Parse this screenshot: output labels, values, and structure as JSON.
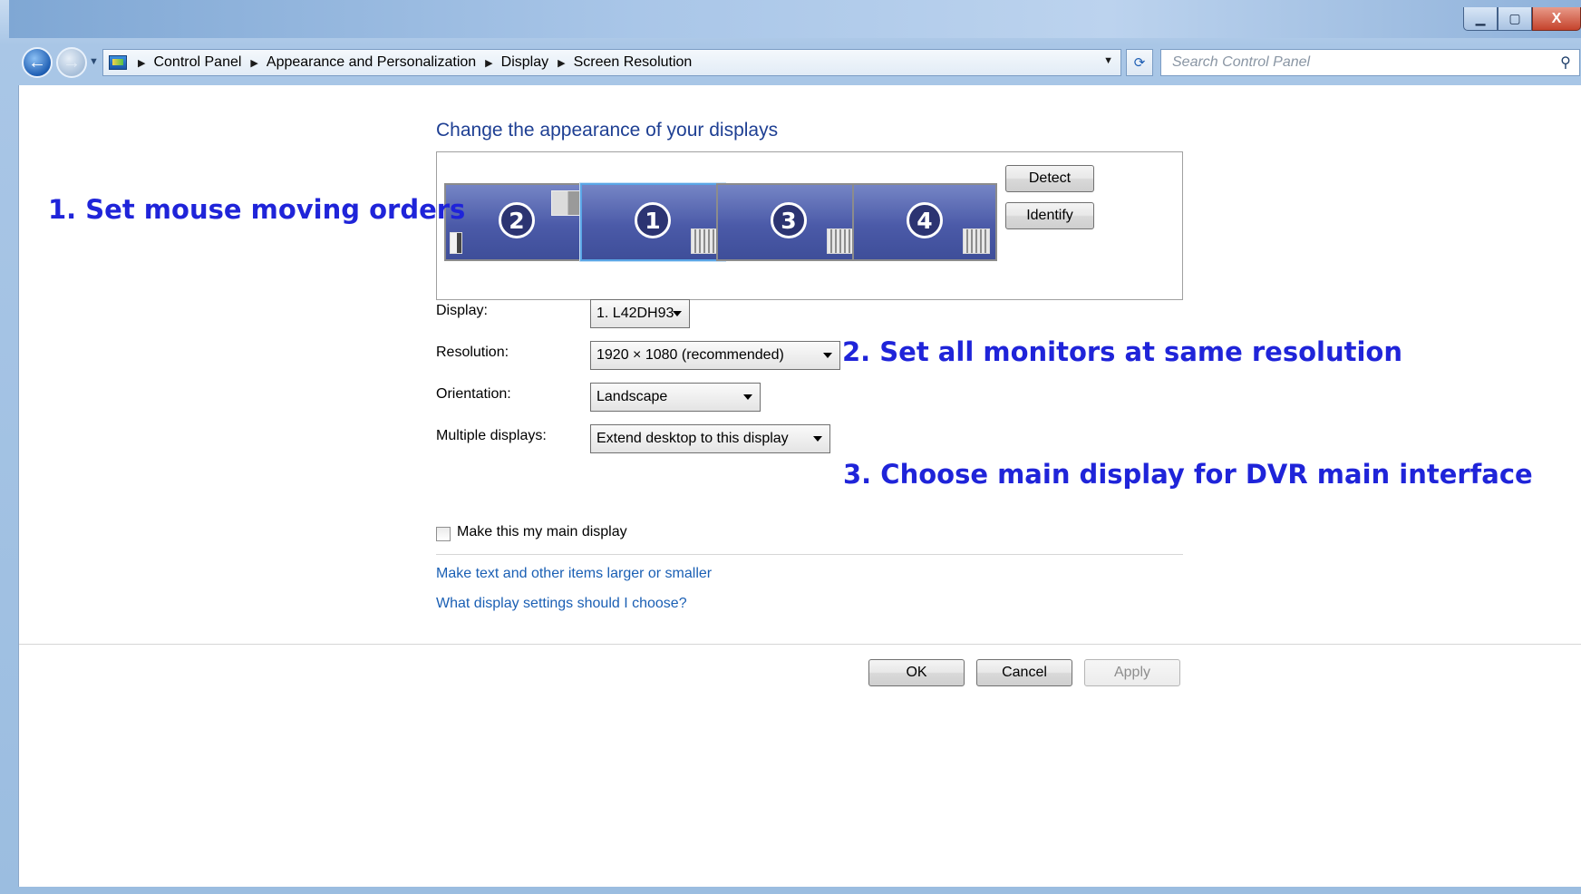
{
  "window": {
    "minimize_glyph": "▁",
    "maximize_glyph": "▢",
    "close_glyph": "X"
  },
  "nav": {
    "breadcrumbs": [
      "Control Panel",
      "Appearance and Personalization",
      "Display",
      "Screen Resolution"
    ],
    "search_placeholder": "Search Control Panel"
  },
  "main": {
    "heading": "Change the appearance of your displays",
    "monitors": [
      {
        "number": "2"
      },
      {
        "number": "1",
        "selected": true
      },
      {
        "number": "3"
      },
      {
        "number": "4"
      }
    ],
    "detect_label": "Detect",
    "identify_label": "Identify",
    "display_label": "Display:",
    "display_value": "1. L42DH93",
    "resolution_label": "Resolution:",
    "resolution_value": "1920 × 1080 (recommended)",
    "orientation_label": "Orientation:",
    "orientation_value": "Landscape",
    "multiple_label": "Multiple displays:",
    "multiple_value": "Extend desktop to this display",
    "main_display_label": "Make this my main display",
    "main_display_checked": false,
    "link_text_size": "Make text and other items larger or smaller",
    "link_settings_help": "What display settings should I choose?",
    "ok_label": "OK",
    "cancel_label": "Cancel",
    "apply_label": "Apply"
  },
  "annotations": {
    "step1": "1. Set mouse moving orders",
    "step2": "2. Set all monitors at same resolution",
    "step3": "3. Choose main display for DVR main interface",
    "color": "#1f24d9"
  }
}
